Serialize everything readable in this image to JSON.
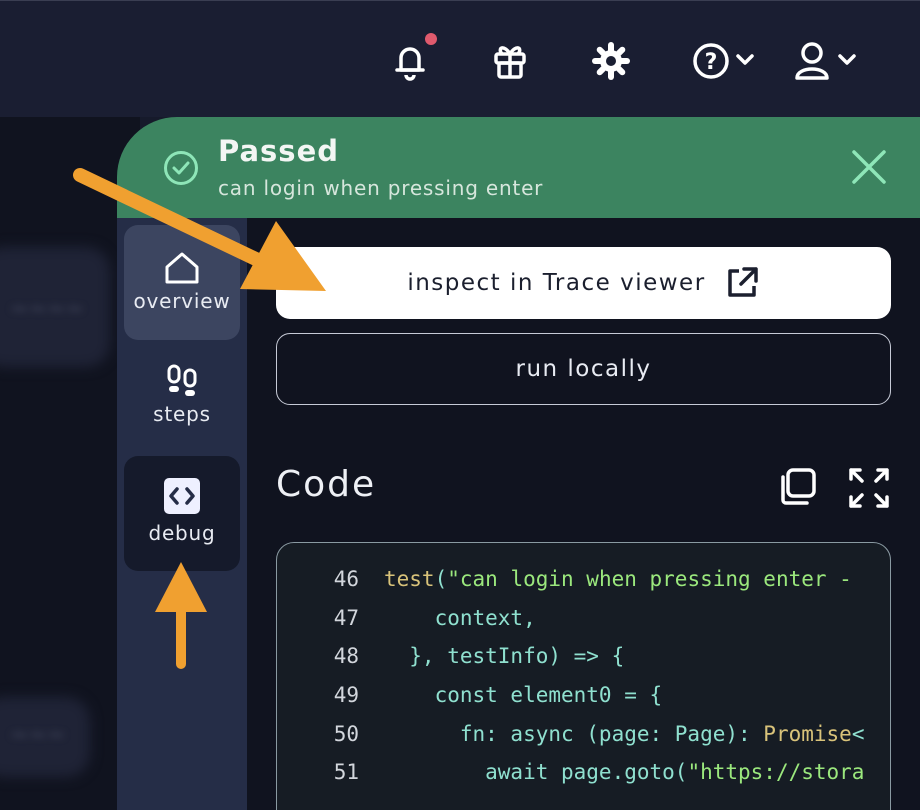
{
  "topbar": {
    "icons": [
      "bell-icon",
      "gift-icon",
      "gear-icon",
      "help-icon",
      "user-icon"
    ],
    "notification_dot_color": "#e05a6d"
  },
  "banner": {
    "status": "Passed",
    "test_name": "can login when pressing enter",
    "color": "#3c8460"
  },
  "sidenav": {
    "items": [
      {
        "label": "overview",
        "icon": "home-icon"
      },
      {
        "label": "steps",
        "icon": "footsteps-icon"
      },
      {
        "label": "debug",
        "icon": "code-icon"
      }
    ]
  },
  "actions": {
    "trace_label": "inspect in Trace viewer",
    "run_label": "run locally"
  },
  "code_section": {
    "title": "Code",
    "lines": [
      {
        "num": "46"
      },
      {
        "num": "47"
      },
      {
        "num": "48"
      },
      {
        "num": "49"
      },
      {
        "num": "50"
      },
      {
        "num": "51"
      }
    ],
    "tokens": {
      "l46_kw": "test",
      "l46_p": "(",
      "l46_str": "\"can login when pressing enter -",
      "l47": "    context,",
      "l48": "  }, testInfo) => {",
      "l49": "    const element0 = {",
      "l50_a": "      fn: async (page: Page): ",
      "l50_kw": "Promise",
      "l50_b": "<",
      "l51_a": "        await page.goto(",
      "l51_str": "\"https://stora"
    }
  },
  "annotations": {
    "arrow_color": "#f0a030"
  }
}
